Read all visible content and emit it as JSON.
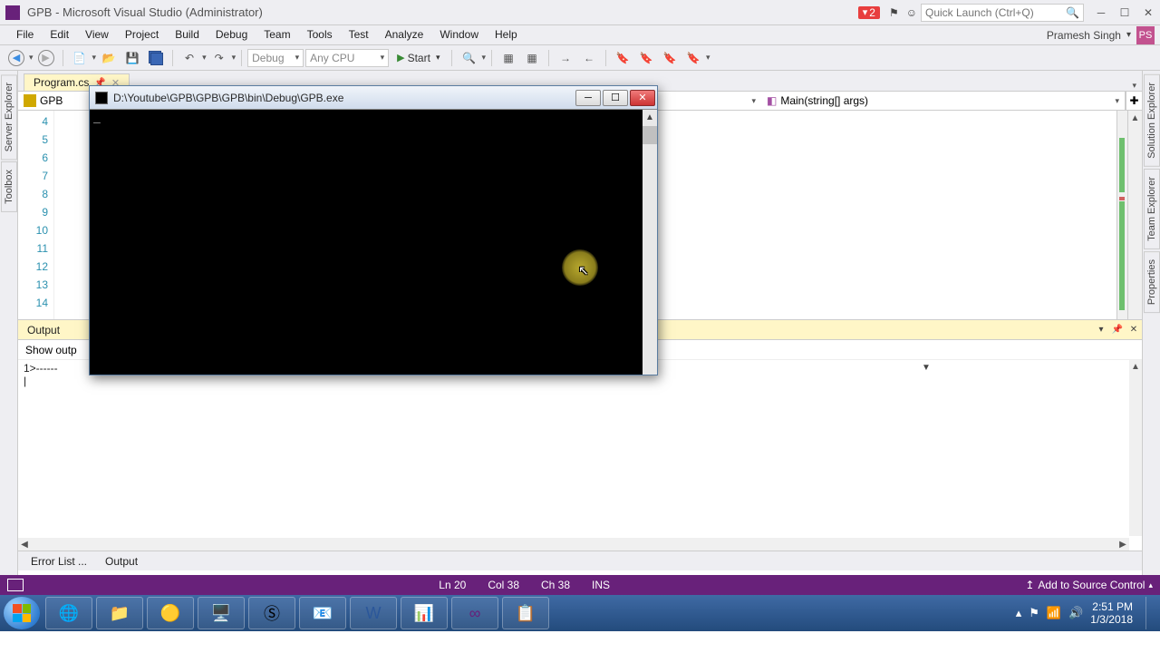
{
  "titlebar": {
    "title": "GPB - Microsoft Visual Studio  (Administrator)",
    "notification_count": "2",
    "quick_launch_placeholder": "Quick Launch (Ctrl+Q)"
  },
  "userbar": {
    "username": "Pramesh Singh",
    "avatar_initials": "PS"
  },
  "menubar": {
    "items": [
      "File",
      "Edit",
      "View",
      "Project",
      "Build",
      "Debug",
      "Team",
      "Tools",
      "Test",
      "Analyze",
      "Window",
      "Help"
    ]
  },
  "toolbar": {
    "config_combo": "Debug",
    "platform_combo": "Any CPU",
    "start_label": "Start"
  },
  "left_tabs": [
    "Server Explorer",
    "Toolbox"
  ],
  "right_tabs": [
    "Solution Explorer",
    "Team Explorer",
    "Properties"
  ],
  "editor": {
    "tab_name": "Program.cs",
    "nav_left": "GPB",
    "nav_right": "Main(string[] args)",
    "line_numbers": [
      "4",
      "5",
      "6",
      "7",
      "8",
      "9",
      "10",
      "11",
      "12",
      "13",
      "14"
    ]
  },
  "console": {
    "title": "D:\\Youtube\\GPB\\GPB\\GPB\\bin\\Debug\\GPB.exe",
    "content": "_"
  },
  "output": {
    "title": "Output",
    "show_from_label": "Show outp",
    "body_line": "1>------"
  },
  "bottom_tabs": {
    "error_list": "Error List ...",
    "output": "Output"
  },
  "statusbar": {
    "ln": "Ln 20",
    "col": "Col 38",
    "ch": "Ch 38",
    "ins": "INS",
    "add_source": "Add to Source Control"
  },
  "taskbar": {
    "apps": [
      "ie",
      "explorer",
      "chrome",
      "remote",
      "skype",
      "outlook",
      "word",
      "publisher",
      "vs",
      "notes"
    ],
    "tray": {
      "time": "2:51 PM",
      "date": "1/3/2018"
    }
  }
}
